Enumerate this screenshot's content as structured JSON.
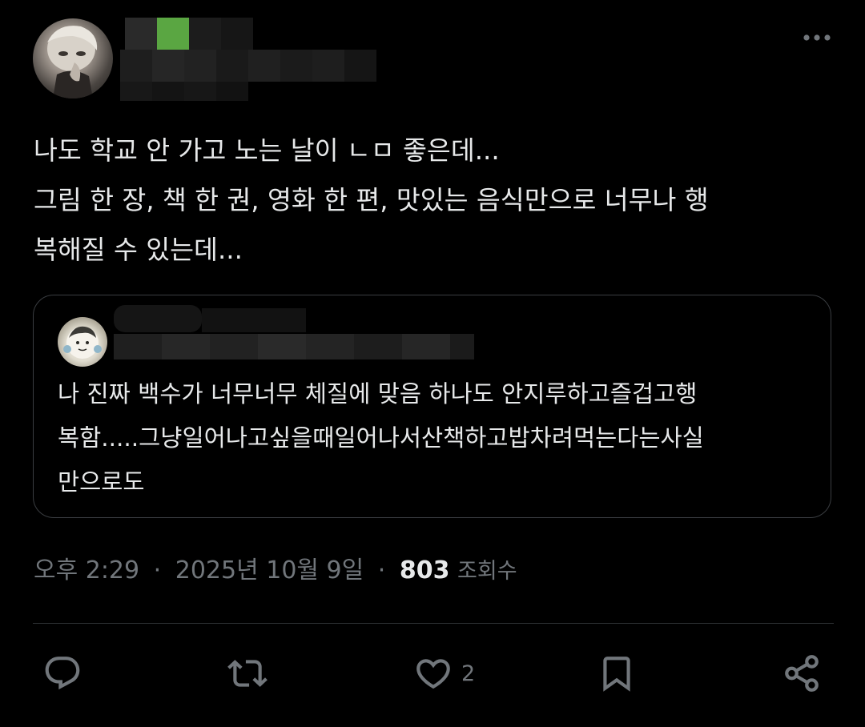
{
  "tweet": {
    "text_lines": [
      "나도 학교 안 가고 노는 날이 ㄴㅁ 좋은데...",
      "그림 한 장, 책 한 권, 영화 한 편, 맛있는 음식만으로 너무나 행",
      "복해질 수 있는데..."
    ],
    "more_icon": "more-horizontal-icon"
  },
  "quoted_tweet": {
    "text_lines": [
      "나 진짜 백수가 너무너무 체질에 맞음 하나도 안지루하고즐겁고행",
      "복함.....그냥일어나고싶을때일어나서산책하고밥차려먹는다는사실",
      "만으로도"
    ]
  },
  "meta": {
    "time": "오후 2:29",
    "separator": "·",
    "date": "2025년 10월 9일",
    "views_count": "803",
    "views_label": "조회수"
  },
  "actions": {
    "reply_icon": "reply-icon",
    "retweet_icon": "retweet-icon",
    "like_icon": "heart-icon",
    "like_count": "2",
    "bookmark_icon": "bookmark-icon",
    "share_icon": "share-icon"
  },
  "colors": {
    "background": "#000000",
    "text": "#e7e9ea",
    "secondary": "#71767b",
    "border": "#3a3d41",
    "divider": "#2f3336"
  }
}
